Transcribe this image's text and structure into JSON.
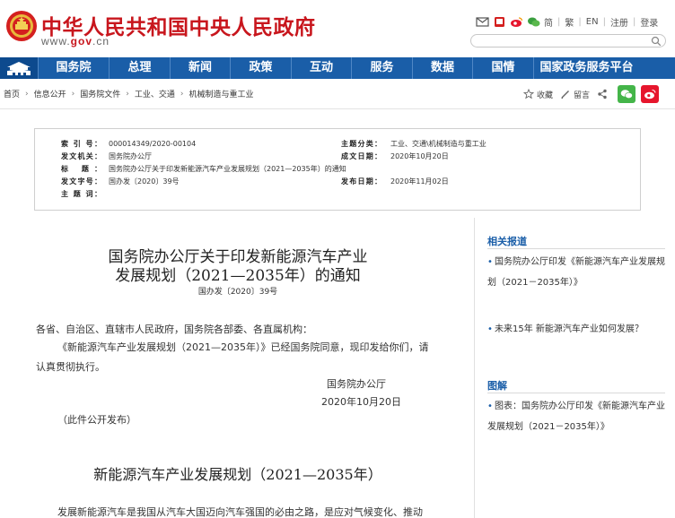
{
  "header": {
    "site_title": "中华人民共和国中央人民政府",
    "url_prefix": "www.",
    "url_gov": "gov",
    "url_suffix": ".cn",
    "links": {
      "lang_cn": "简",
      "lang_tw": "繁",
      "lang_en": "EN",
      "register": "注册",
      "login": "登录"
    }
  },
  "nav": {
    "items": [
      "国务院",
      "总理",
      "新闻",
      "政策",
      "互动",
      "服务",
      "数据",
      "国情",
      "国家政务服务平台"
    ]
  },
  "breadcrumb": {
    "items": [
      "首页",
      "信息公开",
      "国务院文件",
      "工业、交通",
      "机械制造与重工业"
    ],
    "actions": {
      "favorite": "收藏",
      "comment": "留言"
    }
  },
  "info": {
    "index_label": "索 引 号：",
    "index_value": "000014349/2020-00104",
    "theme_label": "主题分类：",
    "theme_value": "工业、交通\\机械制造与重工业",
    "issuer_label": "发文机关：",
    "issuer_value": "国务院办公厅",
    "written_label": "成文日期：",
    "written_value": "2020年10月20日",
    "title_label": "标 题：",
    "title_value": "国务院办公厅关于印发新能源汽车产业发展规划（2021—2035年）的通知",
    "docno_label": "发文字号：",
    "docno_value": "国办发〔2020〕39号",
    "pub_label": "发布日期：",
    "pub_value": "2020年11月02日",
    "subject_label": "主 题 词：",
    "subject_value": ""
  },
  "article": {
    "title_line1": "国务院办公厅关于印发新能源汽车产业",
    "title_line2": "发展规划（2021—2035年）的通知",
    "doc_number": "国办发〔2020〕39号",
    "addressee": "各省、自治区、直辖市人民政府，国务院各部委、各直属机构：",
    "body_line1": "《新能源汽车产业发展规划（2021—2035年）》已经国务院同意，现印发给你们，请",
    "body_line2": "认真贯彻执行。",
    "signer": "国务院办公厅",
    "sign_date": "2020年10月20日",
    "note": "（此件公开发布）",
    "second_title": "新能源汽车产业发展规划（2021—2035年）",
    "body_start": "发展新能源汽车是我国从汽车大国迈向汽车强国的必由之路，是应对气候变化、推动"
  },
  "sidebar": {
    "related_head": "相关报道",
    "related_items": [
      "国务院办公厅印发《新能源汽车产业发展规划（2021－2035年）》",
      "未来15年 新能源汽车产业如何发展？"
    ],
    "graphic_head": "图解",
    "graphic_items": [
      "图表：国务院办公厅印发《新能源汽车产业发展规划（2021－2035年）》"
    ]
  },
  "colors": {
    "brand_red": "#c8161d",
    "nav_blue": "#1a5ea8"
  }
}
